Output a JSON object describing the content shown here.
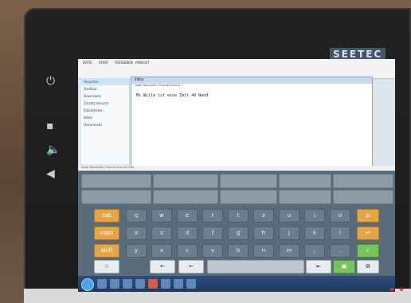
{
  "device": {
    "brand": "SEETEC"
  },
  "app": {
    "ribbon_tabs": [
      "DATEI",
      "START",
      "FREIGEBEN",
      "ANSICHT"
    ],
    "nav_items": [
      "Favoriten",
      "Desktop",
      "Downloads",
      "Zuletzt besucht",
      "Bibliotheken",
      "Bilder",
      "Dokumente"
    ],
    "notepad_title": "Editor",
    "notepad_menu": "Datei Bearbeiten Format Ansicht ?",
    "notepad_text": "Ms Wille ist eine Zeit 40 Wand"
  },
  "status_bar": {
    "text": "Datei  Bearbeiten  Format  Ansicht  Hilfe"
  },
  "keyboard": {
    "row1": [
      "q",
      "w",
      "e",
      "r",
      "t",
      "z",
      "u",
      "i",
      "o",
      "p"
    ],
    "row2": [
      "a",
      "s",
      "d",
      "f",
      "g",
      "h",
      "j",
      "k",
      "l"
    ],
    "row3": [
      "y",
      "x",
      "c",
      "v",
      "b",
      "n",
      "m",
      ",",
      "."
    ],
    "mod_keys": [
      "tab",
      "caps",
      "shift"
    ],
    "backspace": "←",
    "enter": "↵"
  },
  "colors": {
    "accent_orange": "#e3a54a",
    "accent_green": "#78c35d",
    "key_blue_gray": "#6d7f8e"
  }
}
